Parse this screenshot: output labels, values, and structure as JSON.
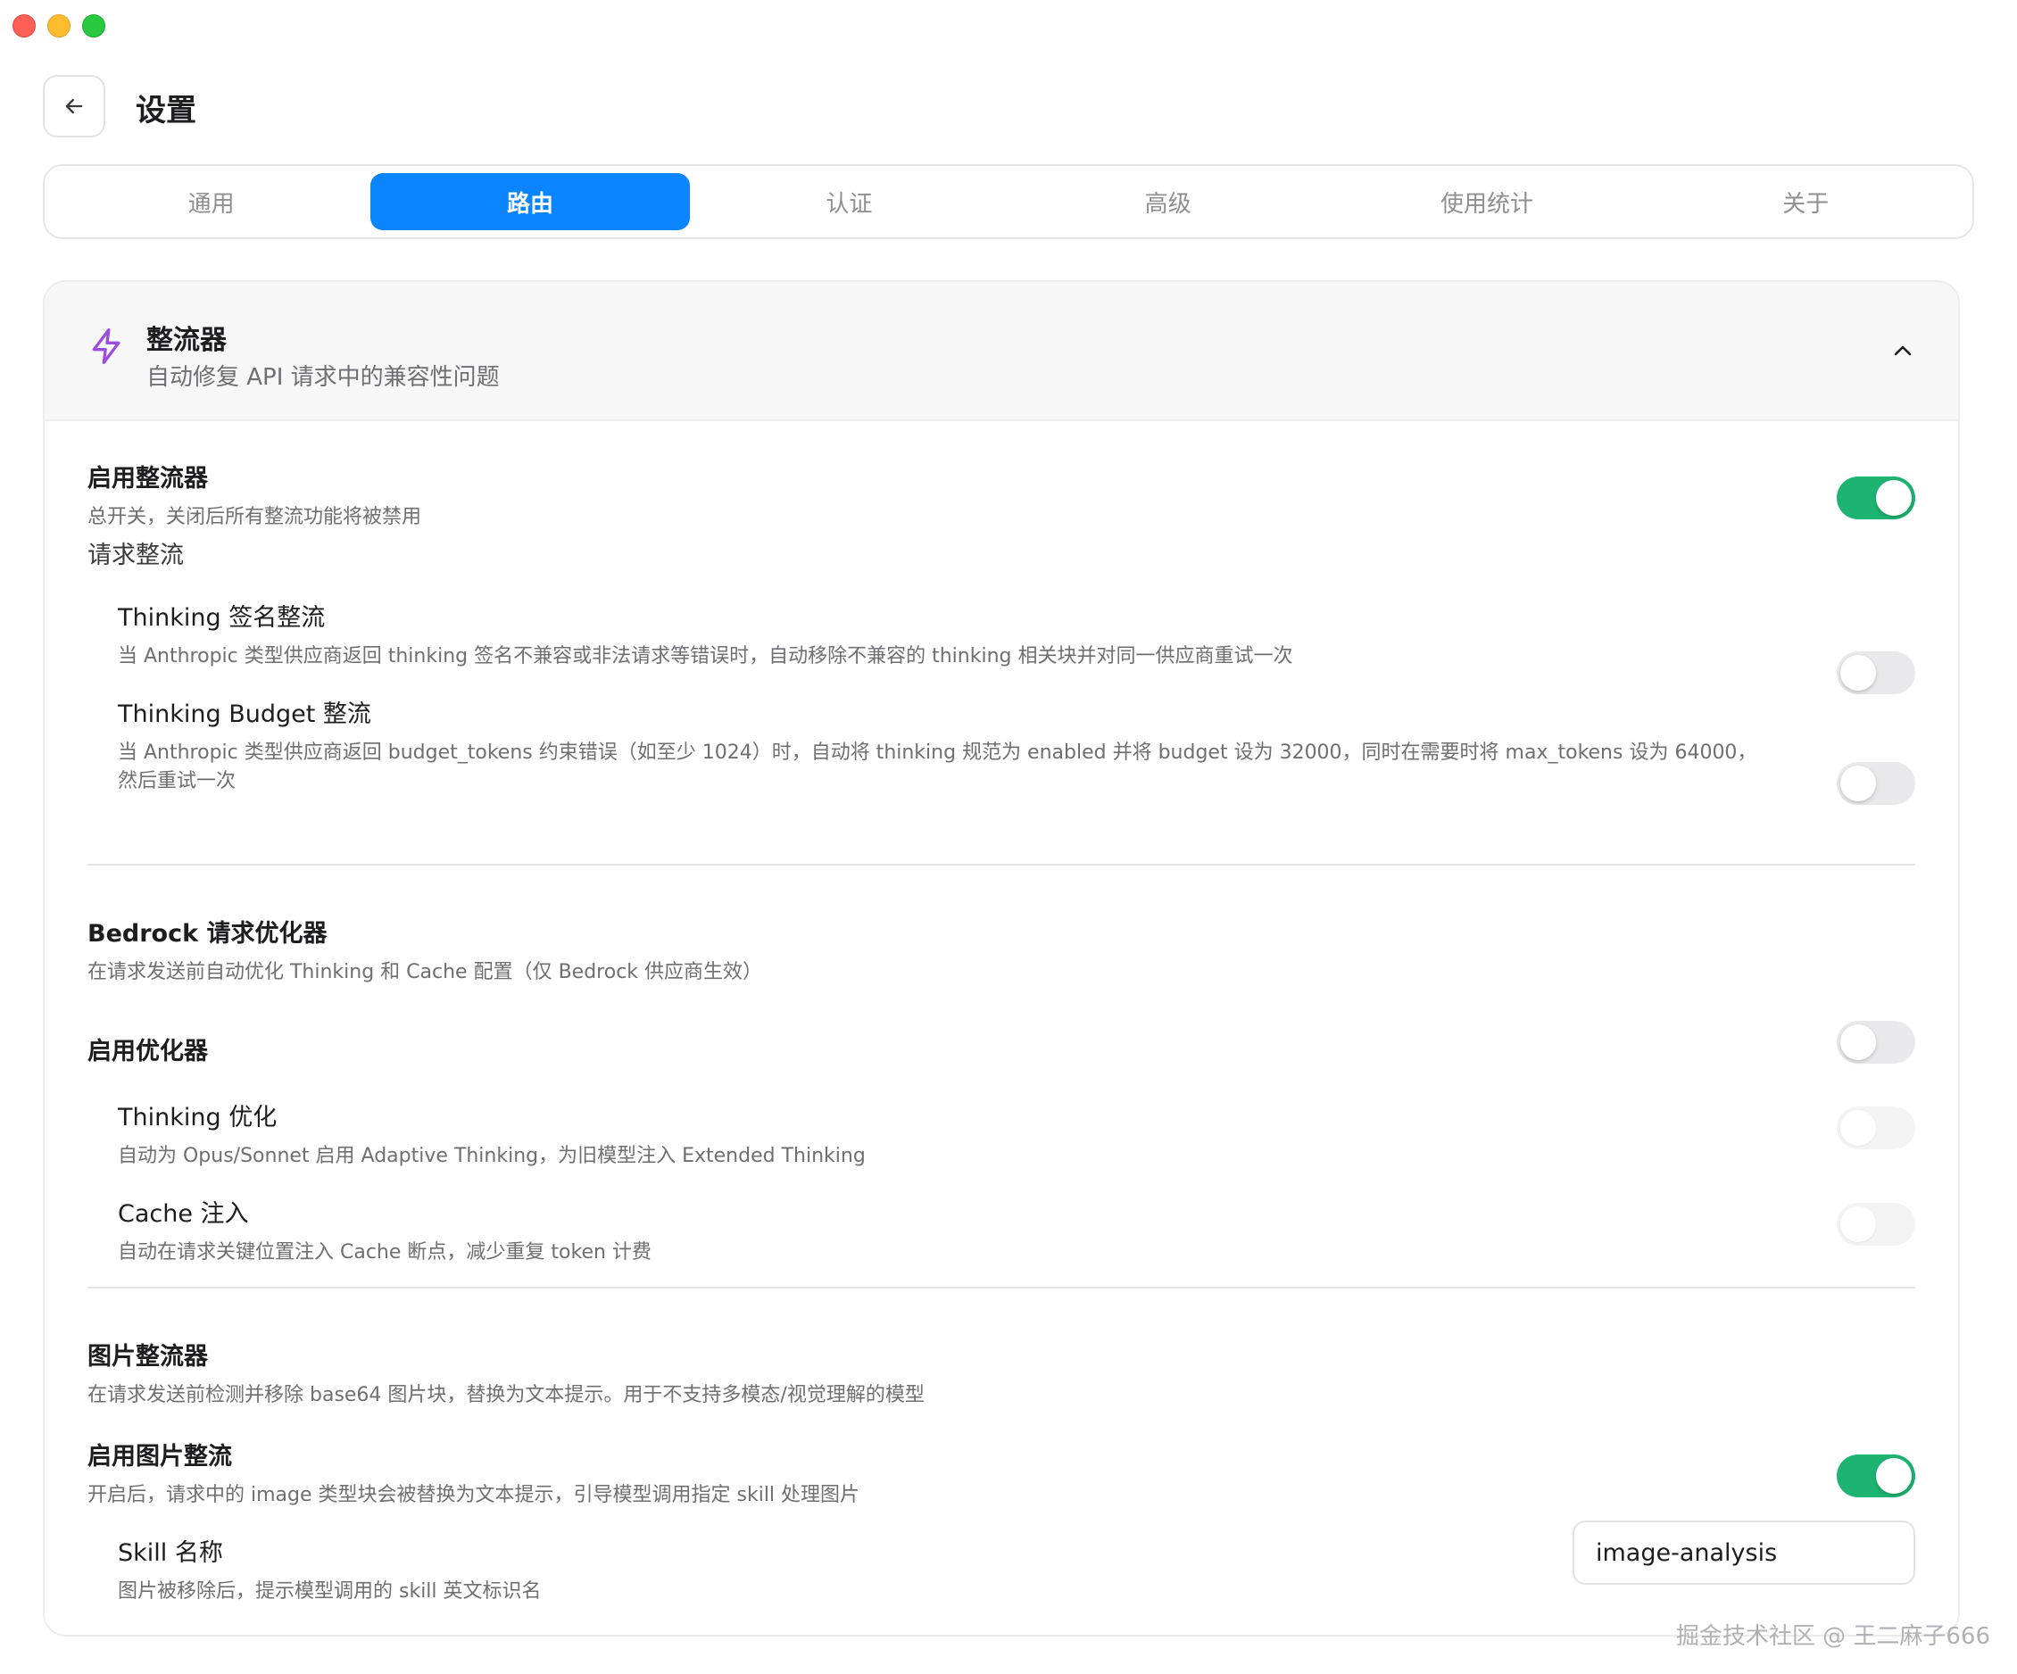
{
  "header": {
    "title": "设置"
  },
  "tabs": [
    {
      "label": "通用",
      "active": false
    },
    {
      "label": "路由",
      "active": true
    },
    {
      "label": "认证",
      "active": false
    },
    {
      "label": "高级",
      "active": false
    },
    {
      "label": "使用统计",
      "active": false
    },
    {
      "label": "关于",
      "active": false
    }
  ],
  "card": {
    "title": "整流器",
    "subtitle": "自动修复 API 请求中的兼容性问题",
    "icon": "lightning-icon",
    "expanded": true
  },
  "rectifier": {
    "enable": {
      "title": "启用整流器",
      "desc": "总开关，关闭后所有整流功能将被禁用",
      "on": true
    },
    "request_section": "请求整流",
    "thinking_signature": {
      "title": "Thinking 签名整流",
      "desc": "当 Anthropic 类型供应商返回 thinking 签名不兼容或非法请求等错误时，自动移除不兼容的 thinking 相关块并对同一供应商重试一次",
      "on": false
    },
    "thinking_budget": {
      "title": "Thinking Budget 整流",
      "desc_line1": "当 Anthropic 类型供应商返回 budget_tokens 约束错误（如至少 1024）时，自动将 thinking 规范为 enabled 并将 budget 设为 32000，同时在需要时将 max_tokens 设为 64000，",
      "desc_line2": "然后重试一次",
      "on": false
    }
  },
  "bedrock": {
    "title": "Bedrock 请求优化器",
    "desc": "在请求发送前自动优化 Thinking 和 Cache 配置（仅 Bedrock 供应商生效）",
    "enable": {
      "title": "启用优化器",
      "on": false
    },
    "thinking": {
      "title": "Thinking 优化",
      "desc": "自动为 Opus/Sonnet 启用 Adaptive Thinking，为旧模型注入 Extended Thinking",
      "on": false
    },
    "cache": {
      "title": "Cache 注入",
      "desc": "自动在请求关键位置注入 Cache 断点，减少重复 token 计费",
      "on": false
    }
  },
  "image": {
    "title": "图片整流器",
    "desc": "在请求发送前检测并移除 base64 图片块，替换为文本提示。用于不支持多模态/视觉理解的模型",
    "enable": {
      "title": "启用图片整流",
      "desc": "开启后，请求中的 image 类型块会被替换为文本提示，引导模型调用指定 skill 处理图片",
      "on": true
    },
    "skill": {
      "title": "Skill 名称",
      "desc": "图片被移除后，提示模型调用的 skill 英文标识名",
      "value": "image-analysis"
    }
  },
  "watermark": "掘金技术社区 @ 王二麻子666",
  "colors": {
    "accent": "#0a84ff",
    "toggle_on": "#1db372",
    "icon": "#9b4de0"
  }
}
